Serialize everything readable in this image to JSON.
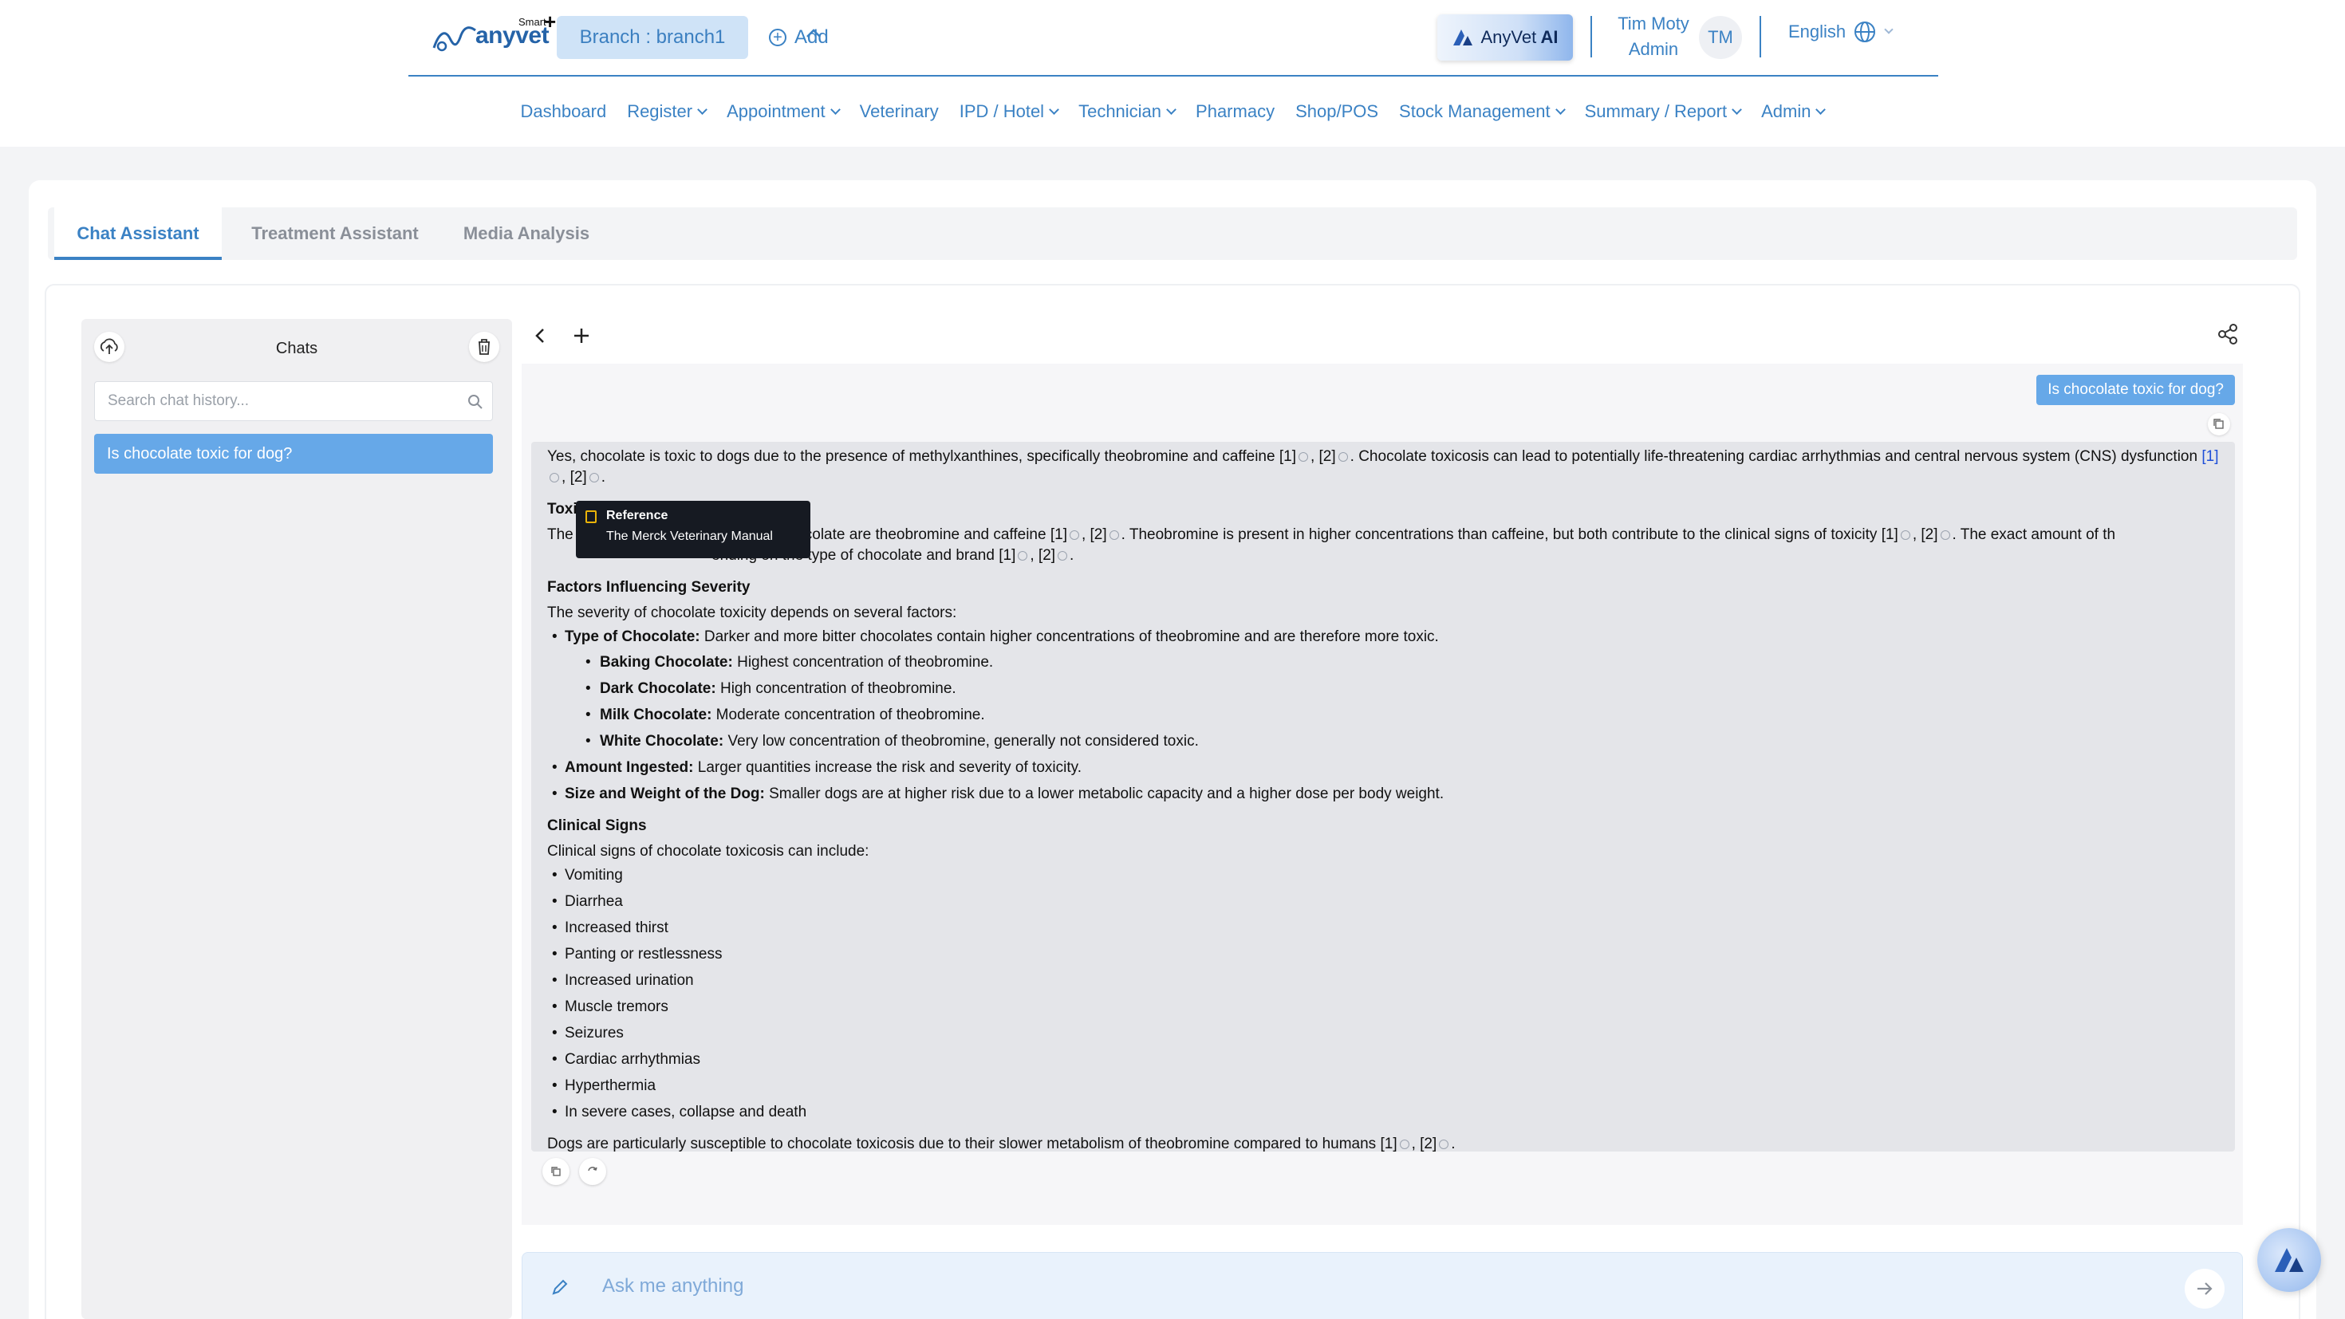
{
  "header": {
    "logo_brand": "anyvet",
    "logo_smart": "Smart",
    "branch_label": "Branch : branch1",
    "add_label": "Add",
    "ai_button_label_1": "AnyVet",
    "ai_button_label_2": "AI",
    "user_name": "Tim Moty",
    "user_role": "Admin",
    "avatar_initials": "TM",
    "language": "English",
    "accent_color": "#3b82c4"
  },
  "nav": {
    "items": [
      {
        "label": "Dashboard",
        "dropdown": false
      },
      {
        "label": "Register",
        "dropdown": true
      },
      {
        "label": "Appointment",
        "dropdown": true
      },
      {
        "label": "Veterinary",
        "dropdown": false
      },
      {
        "label": "IPD / Hotel",
        "dropdown": true
      },
      {
        "label": "Technician",
        "dropdown": true
      },
      {
        "label": "Pharmacy",
        "dropdown": false
      },
      {
        "label": "Shop/POS",
        "dropdown": false
      },
      {
        "label": "Stock Management",
        "dropdown": true
      },
      {
        "label": "Summary / Report",
        "dropdown": true
      },
      {
        "label": "Admin",
        "dropdown": true
      }
    ]
  },
  "tabs": [
    {
      "label": "Chat Assistant",
      "active": true
    },
    {
      "label": "Treatment Assistant",
      "active": false
    },
    {
      "label": "Media Analysis",
      "active": false
    }
  ],
  "sidebar": {
    "title": "Chats",
    "search_placeholder": "Search chat history...",
    "history": [
      "Is chocolate toxic for dog?"
    ]
  },
  "chat": {
    "user_message": "Is chocolate toxic for dog?",
    "answer": {
      "intro_1": "Yes, chocolate is toxic to dogs due to the presence of methylxanthines, specifically theobromine and caffeine",
      "intro_2": ". Chocolate toxicosis can lead to potentially life-threatening cardiac arrhythmias and central nervous system (CNS) dysfunction",
      "toxic_heading_partial": "Toxi",
      "toxic_text_a": "The",
      "toxic_text_b": "colate are theobromine and caffeine",
      "toxic_text_c": ". Theobromine is present in higher concentrations than caffeine, but both contribute to the clinical signs of toxicity",
      "toxic_text_d": ". The exact amount",
      "toxic_text_e": "of th",
      "toxic_text_f": "ending on the type of chocolate and brand",
      "severity_heading": "Factors Influencing Severity",
      "severity_intro": "The severity of chocolate toxicity depends on several factors:",
      "factor_type_label": "Type of Chocolate:",
      "factor_type_text": " Darker and more bitter chocolates contain higher concentrations of theobromine and are therefore more toxic.",
      "chocolate_types": [
        {
          "label": "Baking Chocolate:",
          "text": " Highest concentration of theobromine."
        },
        {
          "label": "Dark Chocolate:",
          "text": " High concentration of theobromine."
        },
        {
          "label": "Milk Chocolate:",
          "text": " Moderate concentration of theobromine."
        },
        {
          "label": "White Chocolate:",
          "text": " Very low concentration of theobromine, generally not considered toxic."
        }
      ],
      "factor_amount_label": "Amount Ingested:",
      "factor_amount_text": " Larger quantities increase the risk and severity of toxicity.",
      "factor_size_label": "Size and Weight of the Dog:",
      "factor_size_text": " Smaller dogs are at higher risk due to a lower metabolic capacity and a higher dose per body weight.",
      "signs_heading": "Clinical Signs",
      "signs_intro": "Clinical signs of chocolate toxicosis can include:",
      "signs": [
        "Vomiting",
        "Diarrhea",
        "Increased thirst",
        "Panting or restlessness",
        "Increased urination",
        "Muscle tremors",
        "Seizures",
        "Cardiac arrhythmias",
        "Hyperthermia",
        "In severe cases, collapse and death"
      ],
      "conclusion": "Dogs are particularly susceptible to chocolate toxicosis due to their slower metabolism of theobromine compared to humans",
      "ref1": "[1]",
      "ref2": "[2]",
      "ref_sep": ", "
    },
    "tooltip": {
      "title": "Reference",
      "source": "The Merck Veterinary Manual"
    },
    "input_placeholder": "Ask me anything"
  },
  "icons": {
    "upload": "upload-cloud-icon",
    "trash": "trash-icon",
    "search": "search-icon",
    "back": "chevron-left-icon",
    "new": "plus-icon",
    "share": "share-icon",
    "copy": "copy-icon",
    "regenerate": "refresh-icon",
    "pen": "pen-icon",
    "send": "arrow-right-icon",
    "globe": "globe-icon"
  }
}
